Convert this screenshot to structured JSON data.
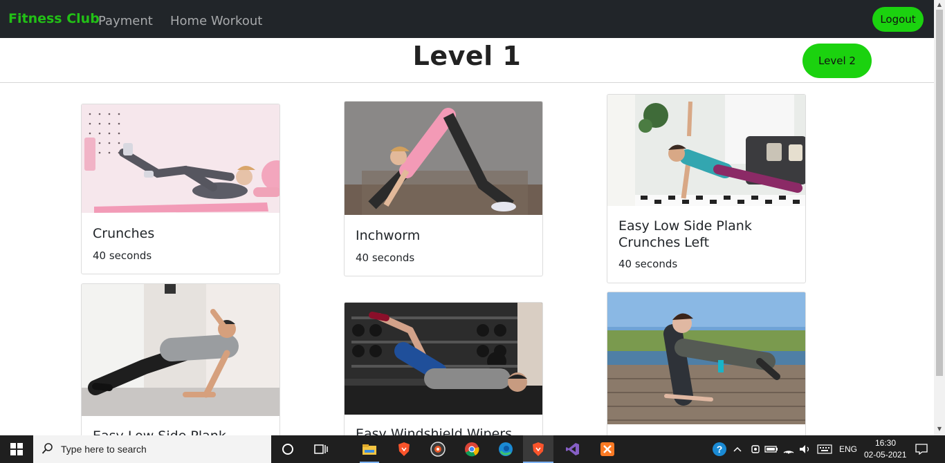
{
  "navbar": {
    "brand": "Fitness Club",
    "links": [
      "Payment",
      "Home Workout"
    ],
    "logout_label": "Logout"
  },
  "header": {
    "title": "Level 1",
    "next_level_label": "Level 2"
  },
  "exercises": [
    {
      "title": "Crunches",
      "duration": "40 seconds"
    },
    {
      "title": "Inchworm",
      "duration": "40 seconds"
    },
    {
      "title": "Easy Low Side Plank Crunches Left",
      "duration": "40 seconds"
    },
    {
      "title": "Easy Low Side Plank",
      "duration": ""
    },
    {
      "title": "Easy Windshield Wipers",
      "duration": ""
    },
    {
      "title": "",
      "duration": ""
    }
  ],
  "taskbar": {
    "search_placeholder": "Type here to search",
    "language": "ENG",
    "time": "16:30",
    "date": "02-05-2021"
  },
  "colors": {
    "navbar_bg": "#212529",
    "brand": "#22c016",
    "button_green": "#1bd20f"
  }
}
